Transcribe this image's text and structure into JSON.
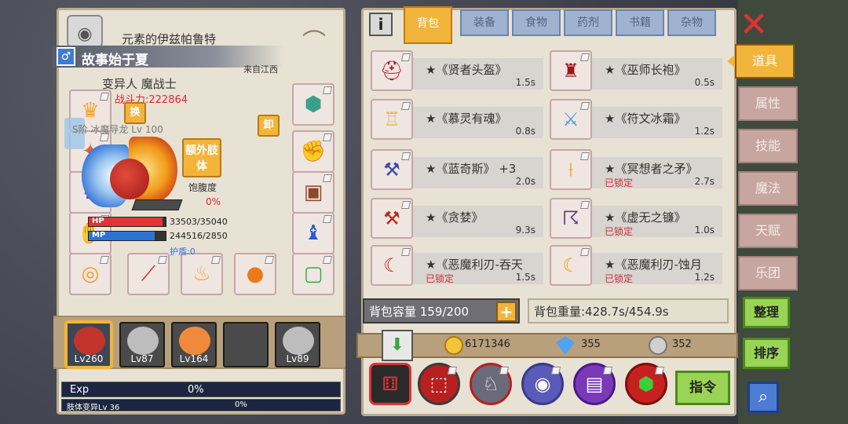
{
  "character": {
    "title": "元素的伊兹帕鲁特",
    "gender_symbol": "♂",
    "name": "故事始于夏",
    "origin": "来自江西",
    "class": "变异人 魔战士",
    "power": "战斗力:222864",
    "swap_label": "换",
    "pet_label": "S阶 冰魔导龙 Lv 100",
    "unequip_label": "卸",
    "extra_limb_label": "额外肢体",
    "hunger_label": "饱腹度",
    "hunger_value": "0%",
    "hp_label": "HP",
    "hp_value": "33503/35040",
    "hp_fraction": 0.956,
    "mp_label": "MP",
    "mp_value": "244516/2850",
    "mp_fraction": 0.86,
    "shield": "护盾:0"
  },
  "party": [
    {
      "level": "Lv260",
      "face": "#c0342c",
      "selected": true
    },
    {
      "level": "Lv87",
      "face": "#bdbdbd"
    },
    {
      "level": "Lv164",
      "face": "#f08a3a"
    },
    {
      "level": "",
      "face": "#4a4a4a"
    },
    {
      "level": "Lv89",
      "face": "#bdbdbd"
    }
  ],
  "exp": {
    "label": "Exp",
    "value": "0%"
  },
  "mutation": {
    "label": "肢体变异Lv 36",
    "value": "0%"
  },
  "inventory": {
    "tabs": [
      "背包",
      "装备",
      "食物",
      "药剂",
      "书籍",
      "杂物"
    ],
    "active_tab": "背包",
    "items": [
      {
        "name": "★《贤者头盔》",
        "weight": "1.5s",
        "locked": "",
        "icon": "helmet-icon"
      },
      {
        "name": "★《巫师长袍》",
        "weight": "0.5s",
        "locked": "",
        "icon": "robe-icon"
      },
      {
        "name": "★《慕灵有魂》",
        "weight": "0.8s",
        "locked": "",
        "icon": "armor-icon"
      },
      {
        "name": "★《符文冰霜》",
        "weight": "1.2s",
        "locked": "",
        "icon": "sword-icon"
      },
      {
        "name": "★《蓝奇斯》 +3",
        "weight": "2.0s",
        "locked": "",
        "icon": "axe-icon"
      },
      {
        "name": "★《冥想者之矛》",
        "weight": "2.7s",
        "locked": "已锁定",
        "icon": "spear-icon"
      },
      {
        "name": "★《贪婪》",
        "weight": "9.3s",
        "locked": "",
        "icon": "axe-icon"
      },
      {
        "name": "★《虚无之镰》",
        "weight": "1.0s",
        "locked": "已锁定",
        "icon": "scythe-icon"
      },
      {
        "name": "★《恶魔利刃-吞天",
        "weight": "1.5s",
        "locked": "已锁定",
        "icon": "blade-icon"
      },
      {
        "name": "★《恶魔利刃-蚀月",
        "weight": "1.2s",
        "locked": "已锁定",
        "icon": "blade-icon"
      }
    ],
    "capacity": "背包容量 159/200",
    "weight": "背包重量:428.7s/454.9s"
  },
  "currency": {
    "gold": "6171346",
    "gems": "355",
    "silver": "352"
  },
  "command_label": "指令",
  "side_tabs": [
    "道具",
    "属性",
    "技能",
    "魔法",
    "天赋",
    "乐团"
  ],
  "active_side_tab": "道具",
  "actions": {
    "arrange": "整理",
    "sort": "排序"
  },
  "colors": {
    "accent": "#f3b43c",
    "hp": "#e23434",
    "mp": "#2d73d6",
    "locked": "#d8283b"
  }
}
